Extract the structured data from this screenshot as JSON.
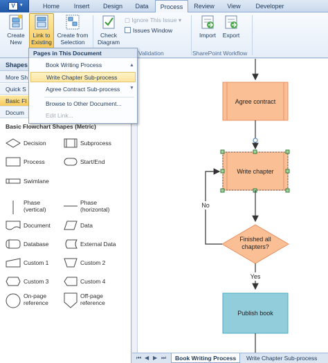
{
  "tabs": [
    {
      "label": "Home"
    },
    {
      "label": "Insert"
    },
    {
      "label": "Design"
    },
    {
      "label": "Data"
    },
    {
      "label": "Process"
    },
    {
      "label": "Review"
    },
    {
      "label": "View"
    },
    {
      "label": "Developer"
    }
  ],
  "active_tab": "Process",
  "ribbon": {
    "create_new": "Create\nNew",
    "link_existing": "Link to\nExisting",
    "create_from_selection": "Create from\nSelection",
    "check_diagram": "Check\nDiagram",
    "ignore_issue": "Ignore This Issue",
    "issues_window": "Issues Window",
    "import": "Import",
    "export": "Export",
    "group_validation": "Validation",
    "group_sharepoint": "SharePoint Workflow"
  },
  "menu": {
    "header": "Pages in This Document",
    "items": [
      "Book Writing Process",
      "Write Chapter Sub-process",
      "Agree Contract Sub-process"
    ],
    "browse": "Browse to Other Document...",
    "edit": "Edit Link..."
  },
  "pane": {
    "title": "Shapes",
    "rows": [
      "More Sh",
      "Quick S",
      "Basic Fl",
      "Docum"
    ],
    "stencil_title": "Basic Flowchart Shapes (Metric)",
    "shapes": [
      {
        "label": "Decision",
        "icon": "diamond-icon"
      },
      {
        "label": "Subprocess",
        "icon": "subprocess-icon"
      },
      {
        "label": "Process",
        "icon": "rectangle-icon"
      },
      {
        "label": "Start/End",
        "icon": "terminator-icon"
      },
      {
        "label": "Swimlane",
        "icon": "swimlane-icon"
      },
      {
        "label": "Phase\n(vertical)",
        "icon": "phase-vertical-icon"
      },
      {
        "label": "Phase\n(horizontal)",
        "icon": "phase-horizontal-icon"
      },
      {
        "label": "Document",
        "icon": "document-icon"
      },
      {
        "label": "Data",
        "icon": "parallelogram-icon"
      },
      {
        "label": "Database",
        "icon": "database-icon"
      },
      {
        "label": "External Data",
        "icon": "external-data-icon"
      },
      {
        "label": "Custom 1",
        "icon": "custom1-icon"
      },
      {
        "label": "Custom 2",
        "icon": "custom2-icon"
      },
      {
        "label": "Custom 3",
        "icon": "custom3-icon"
      },
      {
        "label": "Custom 4",
        "icon": "custom4-icon"
      },
      {
        "label": "On-page\nreference",
        "icon": "circle-icon"
      },
      {
        "label": "Off-page\nreference",
        "icon": "pentagon-icon"
      }
    ]
  },
  "diagram": {
    "agree_contract": "Agree contract",
    "write_chapter": "Write chapter",
    "finished": "Finished all\nchapters?",
    "no_label": "No",
    "yes_label": "Yes",
    "publish": "Publish book"
  },
  "sheets": {
    "active": "Book Writing Process",
    "other": "Write Chapter Sub-process"
  },
  "colors": {
    "process_fill": "#fbbf96",
    "process_stroke": "#e69061",
    "publish_fill": "#92cddc",
    "publish_stroke": "#4aacc6",
    "menu_highlight": "#fde5a0"
  }
}
